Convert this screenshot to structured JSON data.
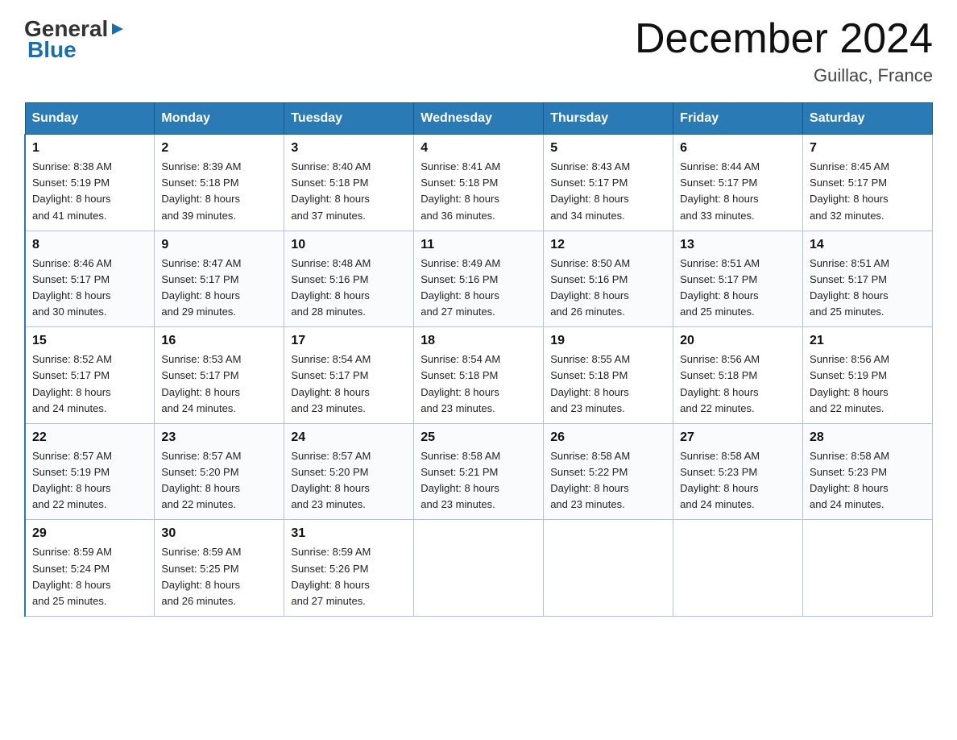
{
  "header": {
    "logo_general": "General",
    "logo_blue": "Blue",
    "month_title": "December 2024",
    "location": "Guillac, France"
  },
  "days_of_week": [
    "Sunday",
    "Monday",
    "Tuesday",
    "Wednesday",
    "Thursday",
    "Friday",
    "Saturday"
  ],
  "weeks": [
    [
      {
        "day": "1",
        "sunrise": "8:38 AM",
        "sunset": "5:19 PM",
        "daylight": "8 hours and 41 minutes."
      },
      {
        "day": "2",
        "sunrise": "8:39 AM",
        "sunset": "5:18 PM",
        "daylight": "8 hours and 39 minutes."
      },
      {
        "day": "3",
        "sunrise": "8:40 AM",
        "sunset": "5:18 PM",
        "daylight": "8 hours and 37 minutes."
      },
      {
        "day": "4",
        "sunrise": "8:41 AM",
        "sunset": "5:18 PM",
        "daylight": "8 hours and 36 minutes."
      },
      {
        "day": "5",
        "sunrise": "8:43 AM",
        "sunset": "5:17 PM",
        "daylight": "8 hours and 34 minutes."
      },
      {
        "day": "6",
        "sunrise": "8:44 AM",
        "sunset": "5:17 PM",
        "daylight": "8 hours and 33 minutes."
      },
      {
        "day": "7",
        "sunrise": "8:45 AM",
        "sunset": "5:17 PM",
        "daylight": "8 hours and 32 minutes."
      }
    ],
    [
      {
        "day": "8",
        "sunrise": "8:46 AM",
        "sunset": "5:17 PM",
        "daylight": "8 hours and 30 minutes."
      },
      {
        "day": "9",
        "sunrise": "8:47 AM",
        "sunset": "5:17 PM",
        "daylight": "8 hours and 29 minutes."
      },
      {
        "day": "10",
        "sunrise": "8:48 AM",
        "sunset": "5:16 PM",
        "daylight": "8 hours and 28 minutes."
      },
      {
        "day": "11",
        "sunrise": "8:49 AM",
        "sunset": "5:16 PM",
        "daylight": "8 hours and 27 minutes."
      },
      {
        "day": "12",
        "sunrise": "8:50 AM",
        "sunset": "5:16 PM",
        "daylight": "8 hours and 26 minutes."
      },
      {
        "day": "13",
        "sunrise": "8:51 AM",
        "sunset": "5:17 PM",
        "daylight": "8 hours and 25 minutes."
      },
      {
        "day": "14",
        "sunrise": "8:51 AM",
        "sunset": "5:17 PM",
        "daylight": "8 hours and 25 minutes."
      }
    ],
    [
      {
        "day": "15",
        "sunrise": "8:52 AM",
        "sunset": "5:17 PM",
        "daylight": "8 hours and 24 minutes."
      },
      {
        "day": "16",
        "sunrise": "8:53 AM",
        "sunset": "5:17 PM",
        "daylight": "8 hours and 24 minutes."
      },
      {
        "day": "17",
        "sunrise": "8:54 AM",
        "sunset": "5:17 PM",
        "daylight": "8 hours and 23 minutes."
      },
      {
        "day": "18",
        "sunrise": "8:54 AM",
        "sunset": "5:18 PM",
        "daylight": "8 hours and 23 minutes."
      },
      {
        "day": "19",
        "sunrise": "8:55 AM",
        "sunset": "5:18 PM",
        "daylight": "8 hours and 23 minutes."
      },
      {
        "day": "20",
        "sunrise": "8:56 AM",
        "sunset": "5:18 PM",
        "daylight": "8 hours and 22 minutes."
      },
      {
        "day": "21",
        "sunrise": "8:56 AM",
        "sunset": "5:19 PM",
        "daylight": "8 hours and 22 minutes."
      }
    ],
    [
      {
        "day": "22",
        "sunrise": "8:57 AM",
        "sunset": "5:19 PM",
        "daylight": "8 hours and 22 minutes."
      },
      {
        "day": "23",
        "sunrise": "8:57 AM",
        "sunset": "5:20 PM",
        "daylight": "8 hours and 22 minutes."
      },
      {
        "day": "24",
        "sunrise": "8:57 AM",
        "sunset": "5:20 PM",
        "daylight": "8 hours and 23 minutes."
      },
      {
        "day": "25",
        "sunrise": "8:58 AM",
        "sunset": "5:21 PM",
        "daylight": "8 hours and 23 minutes."
      },
      {
        "day": "26",
        "sunrise": "8:58 AM",
        "sunset": "5:22 PM",
        "daylight": "8 hours and 23 minutes."
      },
      {
        "day": "27",
        "sunrise": "8:58 AM",
        "sunset": "5:23 PM",
        "daylight": "8 hours and 24 minutes."
      },
      {
        "day": "28",
        "sunrise": "8:58 AM",
        "sunset": "5:23 PM",
        "daylight": "8 hours and 24 minutes."
      }
    ],
    [
      {
        "day": "29",
        "sunrise": "8:59 AM",
        "sunset": "5:24 PM",
        "daylight": "8 hours and 25 minutes."
      },
      {
        "day": "30",
        "sunrise": "8:59 AM",
        "sunset": "5:25 PM",
        "daylight": "8 hours and 26 minutes."
      },
      {
        "day": "31",
        "sunrise": "8:59 AM",
        "sunset": "5:26 PM",
        "daylight": "8 hours and 27 minutes."
      },
      null,
      null,
      null,
      null
    ]
  ],
  "labels": {
    "sunrise": "Sunrise:",
    "sunset": "Sunset:",
    "daylight": "Daylight:"
  }
}
